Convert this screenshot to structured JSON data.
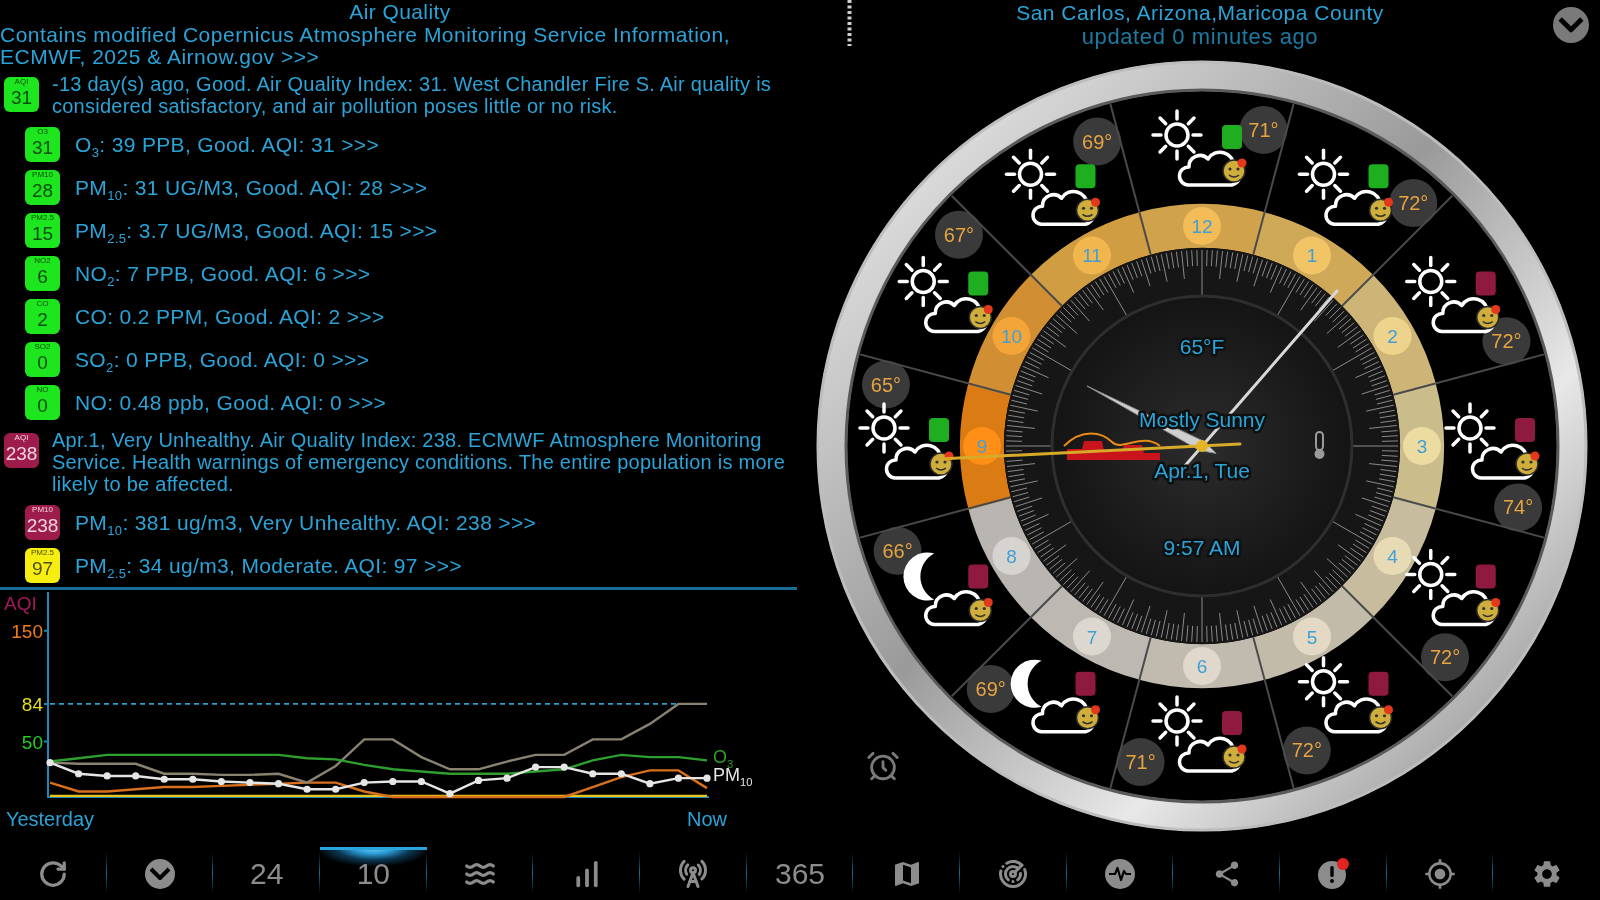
{
  "left_panel": {
    "title": "Air Quality",
    "attribution": "Contains modified Copernicus Atmosphere Monitoring Service Information, ECMWF, 2025 & Airnow.gov >>>",
    "reports": [
      {
        "badge": {
          "label": "AQI",
          "value": "31",
          "color": "#1ee61e"
        },
        "summary": "-13 day(s) ago, Good. Air Quality Index: 31. West Chandler Fire S. Air quality is considered satisfactory, and air pollution poses little or no risk.",
        "pollutants": [
          {
            "badge": {
              "label": "O3",
              "value": "31",
              "color": "#1ee61e"
            },
            "text": "O$_{3}$: 39 PPB, Good. AQI: 31 >>>"
          },
          {
            "badge": {
              "label": "PM10",
              "value": "28",
              "color": "#1ee61e"
            },
            "text": "PM$_{10}$: 31 UG/M3, Good. AQI: 28 >>>"
          },
          {
            "badge": {
              "label": "PM2.5",
              "value": "15",
              "color": "#1ee61e"
            },
            "text": "PM$_{2.5}$: 3.7 UG/M3, Good. AQI: 15 >>>"
          },
          {
            "badge": {
              "label": "NO2",
              "value": "6",
              "color": "#1ee61e"
            },
            "text": "NO$_{2}$: 7 PPB, Good. AQI: 6 >>>"
          },
          {
            "badge": {
              "label": "CO",
              "value": "2",
              "color": "#1ee61e"
            },
            "text": "CO: 0.2 PPM, Good. AQI: 2 >>>"
          },
          {
            "badge": {
              "label": "SO2",
              "value": "0",
              "color": "#1ee61e"
            },
            "text": "SO$_{2}$: 0 PPB, Good. AQI: 0 >>>"
          },
          {
            "badge": {
              "label": "NO",
              "value": "0",
              "color": "#1ee61e"
            },
            "text": "NO: 0.48 ppb, Good. AQI: 0 >>>"
          }
        ]
      },
      {
        "badge": {
          "label": "AQI",
          "value": "238",
          "color": "#9e1c4c"
        },
        "summary": "Apr.1, Very Unhealthy. Air Quality Index: 238. ECMWF Atmosphere Monitoring Service. Health warnings of emergency conditions. The entire population is more likely to be affected.",
        "pollutants": [
          {
            "badge": {
              "label": "PM10",
              "value": "238",
              "color": "#9e1c4c"
            },
            "text": "PM$_{10}$: 381 ug/m3, Very Unhealthy. AQI: 238 >>>"
          },
          {
            "badge": {
              "label": "PM2.5",
              "value": "97",
              "color": "#f5ee10"
            },
            "text": "PM$_{2.5}$: 34 ug/m3, Moderate. AQI: 97 >>>"
          }
        ]
      }
    ],
    "aqi_chart": {
      "chart_data": {
        "type": "line",
        "ylabel": "AQI",
        "categories": [
          "Yesterday",
          null,
          null,
          null,
          null,
          null,
          null,
          null,
          null,
          null,
          null,
          null,
          null,
          null,
          null,
          null,
          null,
          null,
          null,
          null,
          null,
          null,
          null,
          "Now"
        ],
        "ylim": [
          0,
          185
        ],
        "yticks": [
          50,
          84,
          150
        ],
        "ref_lines": [
          {
            "axis": "y",
            "value": 84,
            "color": "#2a9fd0",
            "line_style": "dashed"
          }
        ],
        "series": [
          {
            "color": "#e8c41c",
            "values": [
              1,
              1,
              1,
              1,
              1,
              1,
              1,
              1,
              1,
              1,
              1,
              1,
              1,
              1,
              1,
              1,
              1,
              1,
              1,
              1,
              1,
              1,
              1,
              1
            ]
          },
          {
            "color": "#d8701c",
            "values": [
              13,
              5,
              5,
              7,
              9,
              9,
              10,
              11,
              12,
              13,
              13,
              5,
              0,
              0,
              0,
              0,
              0,
              0,
              0,
              9,
              18,
              24,
              24,
              8
            ]
          },
          {
            "color": "#8a8270",
            "values": [
              31,
              30,
              30,
              30,
              21,
              21,
              20,
              20,
              21,
              13,
              28,
              52,
              52,
              36,
              25,
              25,
              32,
              38,
              38,
              52,
              52,
              66,
              84,
              84
            ]
          },
          {
            "name": "O$_{3}$",
            "color": "#2e9e2e",
            "values": [
              32,
              35,
              38,
              38,
              38,
              38,
              38,
              38,
              38,
              35,
              34,
              29,
              25,
              23,
              21,
              21,
              21,
              23,
              25,
              33,
              38,
              36,
              36,
              33
            ]
          },
          {
            "name": "PM$_{10}$",
            "color": "#e6e6e6",
            "marker": "circle",
            "values": [
              31,
              21,
              19,
              19,
              16,
              16,
              14,
              13,
              12,
              7,
              7,
              13,
              14,
              14,
              3,
              15,
              17,
              27,
              27,
              21,
              21,
              12,
              17,
              17
            ]
          }
        ]
      }
    }
  },
  "clock_panel": {
    "location": "San Carlos, Arizona,Maricopa County",
    "updated": "updated 0 minutes ago",
    "clock": {
      "temperature": "65°F",
      "condition": "Mostly Sunny",
      "date": "Apr.1, Tue",
      "time": "9:57 AM",
      "hours": [
        {
          "label": "12",
          "color": "#f2bc58"
        },
        {
          "label": "1",
          "color": "#f1c466"
        },
        {
          "label": "2",
          "color": "#eed38c"
        },
        {
          "label": "3",
          "color": "#ecdca2"
        },
        {
          "label": "4",
          "color": "#e7dbb6"
        },
        {
          "label": "5",
          "color": "#e3d9c4"
        },
        {
          "label": "6",
          "color": "#e0d9cb"
        },
        {
          "label": "7",
          "color": "#dcd7cf"
        },
        {
          "label": "8",
          "color": "#d7d4cf"
        },
        {
          "label": "9",
          "color": "#ff8f16"
        },
        {
          "label": "10",
          "color": "#f4a53a"
        },
        {
          "label": "11",
          "color": "#f2b64e"
        }
      ],
      "forecast": [
        {
          "temp": "71°",
          "kind": "sun",
          "color": "#1fae1f"
        },
        {
          "temp": "72°",
          "kind": "sun",
          "color": "#1fae1f"
        },
        {
          "temp": "72°",
          "kind": "sun",
          "color": "#8e1a40"
        },
        {
          "temp": "74°",
          "kind": "sun",
          "color": "#8e1a40"
        },
        {
          "temp": "72°",
          "kind": "sun",
          "color": "#8e1a40"
        },
        {
          "temp": "72°",
          "kind": "sun",
          "color": "#8e1a40"
        },
        {
          "temp": "71°",
          "kind": "sun",
          "color": "#8e1a40"
        },
        {
          "temp": "69°",
          "kind": "moon",
          "color": "#8e1a40"
        },
        {
          "temp": "66°",
          "kind": "moon",
          "color": "#8e1a40"
        },
        {
          "temp": "65°",
          "kind": "sun",
          "color": "#1fae1f"
        },
        {
          "temp": "67°",
          "kind": "sun",
          "color": "#1fae1f"
        },
        {
          "temp": "69°",
          "kind": "sun",
          "color": "#1fae1f"
        }
      ]
    }
  },
  "toolbar": {
    "items": [
      {
        "kind": "icon",
        "selected": false
      },
      {
        "kind": "icon",
        "selected": false
      },
      {
        "kind": "text",
        "label": "24",
        "selected": false
      },
      {
        "kind": "text",
        "label": "10",
        "selected": true
      },
      {
        "kind": "icon",
        "selected": false
      },
      {
        "kind": "icon",
        "selected": false
      },
      {
        "kind": "icon",
        "selected": false
      },
      {
        "kind": "text",
        "label": "365",
        "selected": false
      },
      {
        "kind": "icon",
        "selected": false
      },
      {
        "kind": "icon",
        "selected": false
      },
      {
        "kind": "icon",
        "selected": false
      },
      {
        "kind": "icon",
        "selected": false
      },
      {
        "kind": "icon",
        "selected": false
      },
      {
        "kind": "icon",
        "selected": false
      },
      {
        "kind": "icon",
        "selected": false
      }
    ]
  }
}
